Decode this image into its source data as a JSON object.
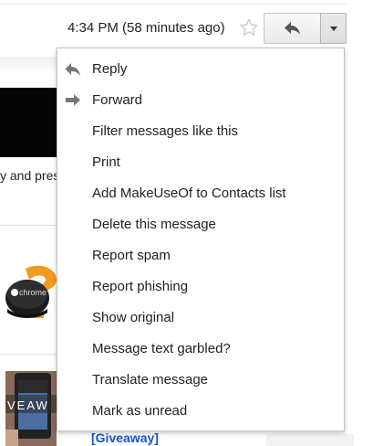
{
  "header": {
    "timestamp": "4:34 PM (58 minutes ago)",
    "star_icon": "star-outline-icon",
    "reply_button_icon": "reply-arrow-icon",
    "more_button_icon": "caret-down-icon"
  },
  "background": {
    "snippet_text": "y and pres",
    "chromecast_logo_text": "chrome",
    "giveaway_thumb_text": "VEAW",
    "giveaway_link": "[Giveaway]"
  },
  "menu": {
    "items": [
      {
        "label": "Reply",
        "icon": "reply-icon"
      },
      {
        "label": "Forward",
        "icon": "forward-icon"
      },
      {
        "label": "Filter messages like this"
      },
      {
        "label": "Print"
      },
      {
        "label": "Add MakeUseOf to Contacts list"
      },
      {
        "label": "Delete this message"
      },
      {
        "label": "Report spam"
      },
      {
        "label": "Report phishing"
      },
      {
        "label": "Show original"
      },
      {
        "label": "Message text garbled?"
      },
      {
        "label": "Translate message"
      },
      {
        "label": "Mark as unread"
      }
    ]
  },
  "colors": {
    "link": "#1155cc",
    "icon_gray": "#777777",
    "chromecast_orange": "#f39a1f"
  }
}
